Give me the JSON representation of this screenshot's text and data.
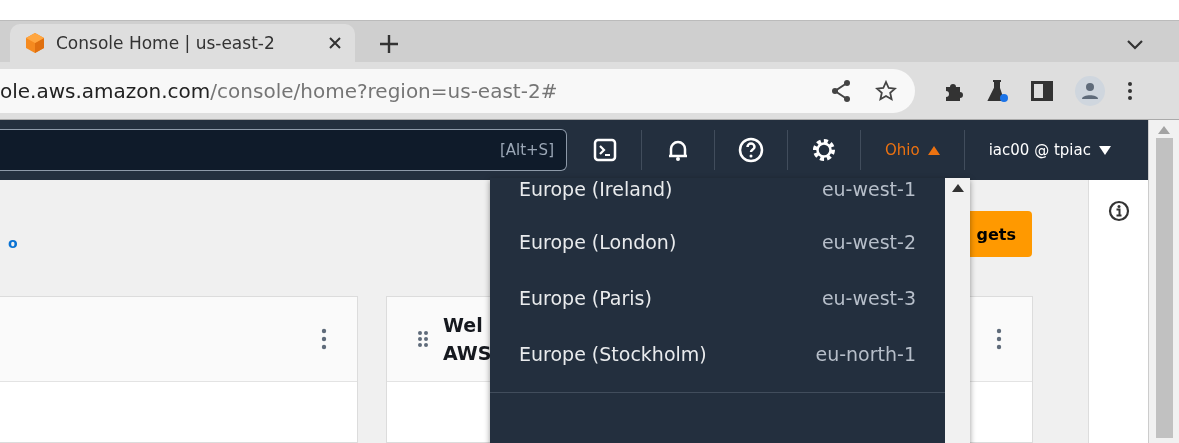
{
  "browser_tab": {
    "title": "Console Home | us-east-2",
    "selected": true
  },
  "address": {
    "host": "ole.aws.amazon.com",
    "path": "/console/home?region=us-east-2#"
  },
  "nav": {
    "search_shortcut": "[Alt+S]",
    "region": "Ohio",
    "account": "iac00 @ tpiac"
  },
  "page": {
    "link": "o",
    "button": "gets",
    "cards": [
      {
        "kind": "plain"
      },
      {
        "kind": "titled",
        "title_lines": [
          "Wel",
          "AWS"
        ]
      }
    ]
  },
  "region_menu": {
    "items": [
      {
        "name": "Europe (Ireland)",
        "code": "eu-west-1",
        "divider_after": false
      },
      {
        "name": "Europe (London)",
        "code": "eu-west-2",
        "divider_after": false
      },
      {
        "name": "Europe (Paris)",
        "code": "eu-west-3",
        "divider_after": false
      },
      {
        "name": "Europe (Stockholm)",
        "code": "eu-north-1",
        "divider_after": true
      }
    ]
  }
}
